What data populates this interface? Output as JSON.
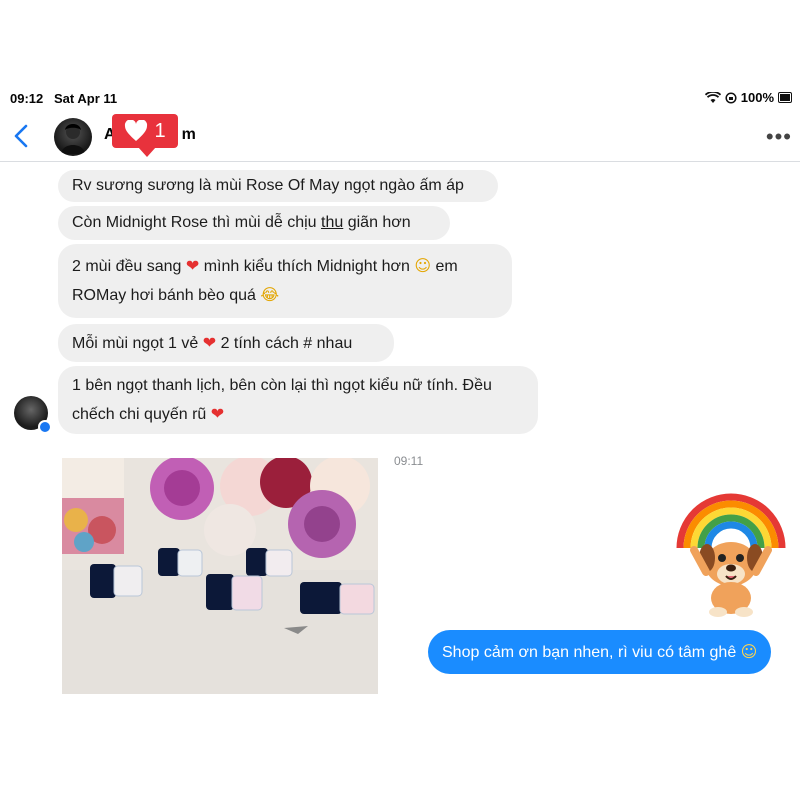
{
  "status_bar": {
    "time": "09:12",
    "date": "Sat Apr 11",
    "battery": "100%"
  },
  "header": {
    "name_prefix": "A",
    "name_suffix": "m"
  },
  "like_badge": {
    "count": "1"
  },
  "messages": [
    {
      "text": "Rv sương sương là mùi Rose Of May ngọt ngào ấm áp"
    },
    {
      "pre": "Còn Midnight Rose thì mùi dễ chịu ",
      "underlined": "thu",
      "post": " giãn hơn"
    },
    {
      "line1_a": "2 mùi đều sang ",
      "line1_b": " mình kiểu thích Midnight hơn ",
      "line1_c": " em",
      "line2": "ROMay hơi bánh bèo quá "
    },
    {
      "pre": "Mỗi mùi ngọt 1 vẻ ",
      "post": " 2 tính cách # nhau"
    },
    {
      "line1": "1 bên ngọt thanh lịch, bên còn lại thì ngọt kiểu nữ tính. Đều",
      "line2": "chếch chi quyến rũ "
    }
  ],
  "emojis": {
    "heart": "❤",
    "smile": "☺",
    "laugh": "😂",
    "relieved": "☺"
  },
  "timestamp": "09:11",
  "outgoing": {
    "text": "Shop cảm ơn bạn nhen, rì viu có tâm ghê "
  },
  "colors": {
    "outgoing_bubble": "#1a8cff",
    "incoming_bubble": "#efefef",
    "accent": "#1877f2",
    "like_badge": "#e8323c"
  }
}
